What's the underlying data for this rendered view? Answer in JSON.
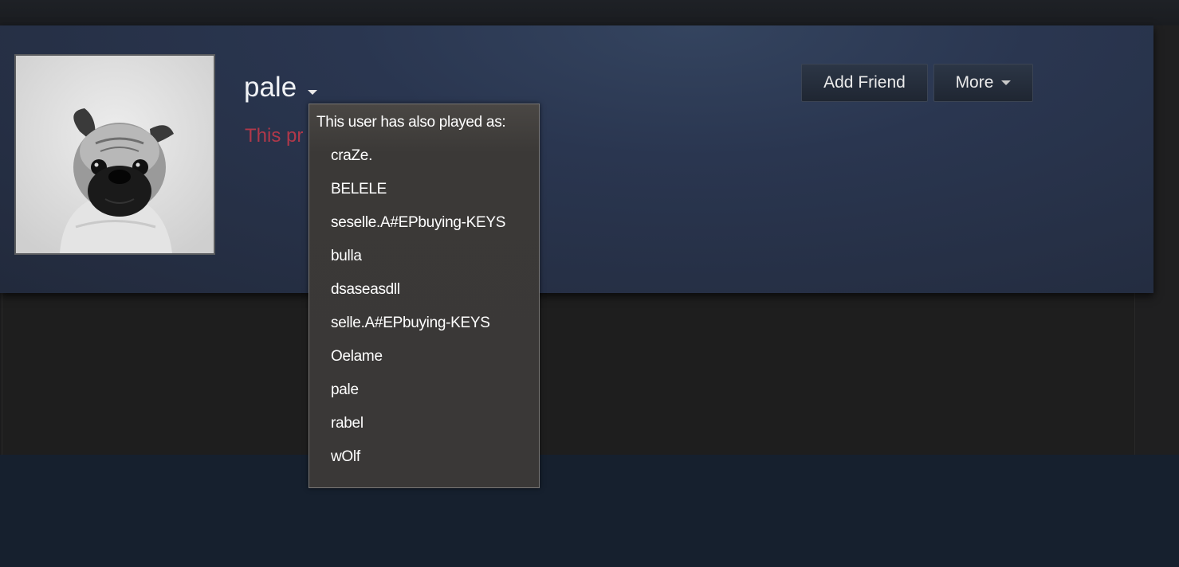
{
  "profile": {
    "name": "pale",
    "private_text": "This pr"
  },
  "actions": {
    "add_friend_label": "Add Friend",
    "more_label": "More"
  },
  "alias_dropdown": {
    "title": "This user has also played as:",
    "aliases": [
      "craZe.",
      "BELELE",
      "seselle.A#EPbuying-KEYS",
      "bulla",
      "dsaseasdll",
      "selle.A#EPbuying-KEYS",
      "Oelame",
      "pale",
      "rabel",
      "wOlf"
    ]
  },
  "icons": {
    "name_dropdown": "caret-down-icon",
    "more_dropdown": "caret-down-icon"
  },
  "colors": {
    "private_text": "#b0384a",
    "header_bg": "#2a3650",
    "dropdown_bg": "#3b3937"
  }
}
